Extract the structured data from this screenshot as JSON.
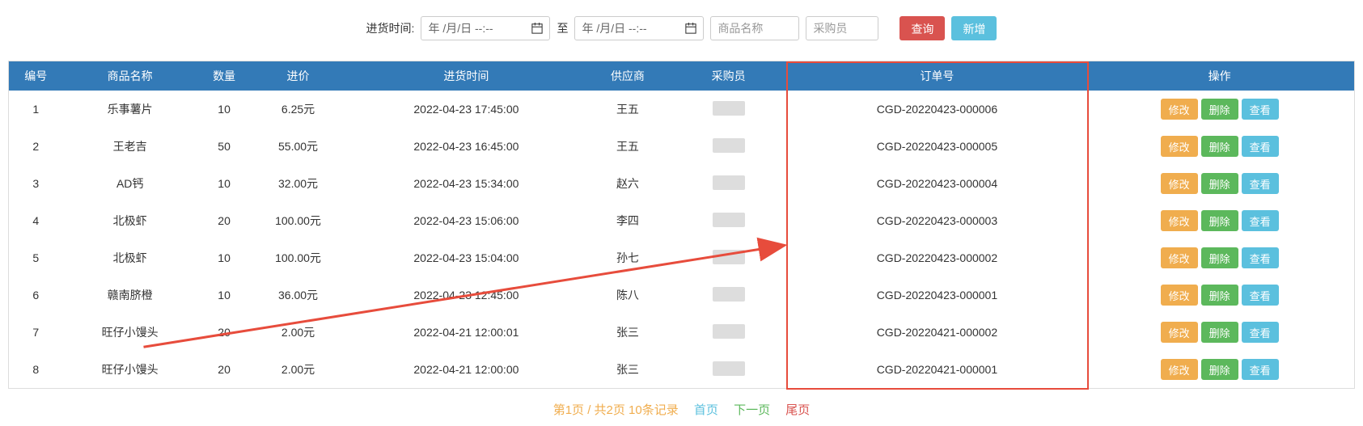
{
  "filter": {
    "time_label": "进货时间:",
    "date_placeholder": "年 /月/日 --:--",
    "to_label": "至",
    "product_placeholder": "商品名称",
    "buyer_placeholder": "采购员",
    "search_btn": "查询",
    "add_btn": "新增"
  },
  "table": {
    "headers": [
      "编号",
      "商品名称",
      "数量",
      "进价",
      "进货时间",
      "供应商",
      "采购员",
      "订单号",
      "操作"
    ],
    "rows": [
      {
        "id": "1",
        "product": "乐事薯片",
        "qty": "10",
        "price": "6.25元",
        "time": "2022-04-23 17:45:00",
        "supplier": "王五",
        "order": "CGD-20220423-000006"
      },
      {
        "id": "2",
        "product": "王老吉",
        "qty": "50",
        "price": "55.00元",
        "time": "2022-04-23 16:45:00",
        "supplier": "王五",
        "order": "CGD-20220423-000005"
      },
      {
        "id": "3",
        "product": "AD钙",
        "qty": "10",
        "price": "32.00元",
        "time": "2022-04-23 15:34:00",
        "supplier": "赵六",
        "order": "CGD-20220423-000004"
      },
      {
        "id": "4",
        "product": "北极虾",
        "qty": "20",
        "price": "100.00元",
        "time": "2022-04-23 15:06:00",
        "supplier": "李四",
        "order": "CGD-20220423-000003"
      },
      {
        "id": "5",
        "product": "北极虾",
        "qty": "10",
        "price": "100.00元",
        "time": "2022-04-23 15:04:00",
        "supplier": "孙七",
        "order": "CGD-20220423-000002"
      },
      {
        "id": "6",
        "product": "赣南脐橙",
        "qty": "10",
        "price": "36.00元",
        "time": "2022-04-23 12:45:00",
        "supplier": "陈八",
        "order": "CGD-20220423-000001"
      },
      {
        "id": "7",
        "product": "旺仔小馒头",
        "qty": "20",
        "price": "2.00元",
        "time": "2022-04-21 12:00:01",
        "supplier": "张三",
        "order": "CGD-20220421-000002"
      },
      {
        "id": "8",
        "product": "旺仔小馒头",
        "qty": "20",
        "price": "2.00元",
        "time": "2022-04-21 12:00:00",
        "supplier": "张三",
        "order": "CGD-20220421-000001"
      }
    ],
    "op_edit": "修改",
    "op_delete": "删除",
    "op_view": "查看"
  },
  "pagination": {
    "info": "第1页 / 共2页 10条记录",
    "first": "首页",
    "next": "下一页",
    "last": "尾页"
  },
  "highlight": {
    "annotation": "highlight-box-order-column",
    "arrow_annotation": "arrow-pointing-to-order-column"
  }
}
